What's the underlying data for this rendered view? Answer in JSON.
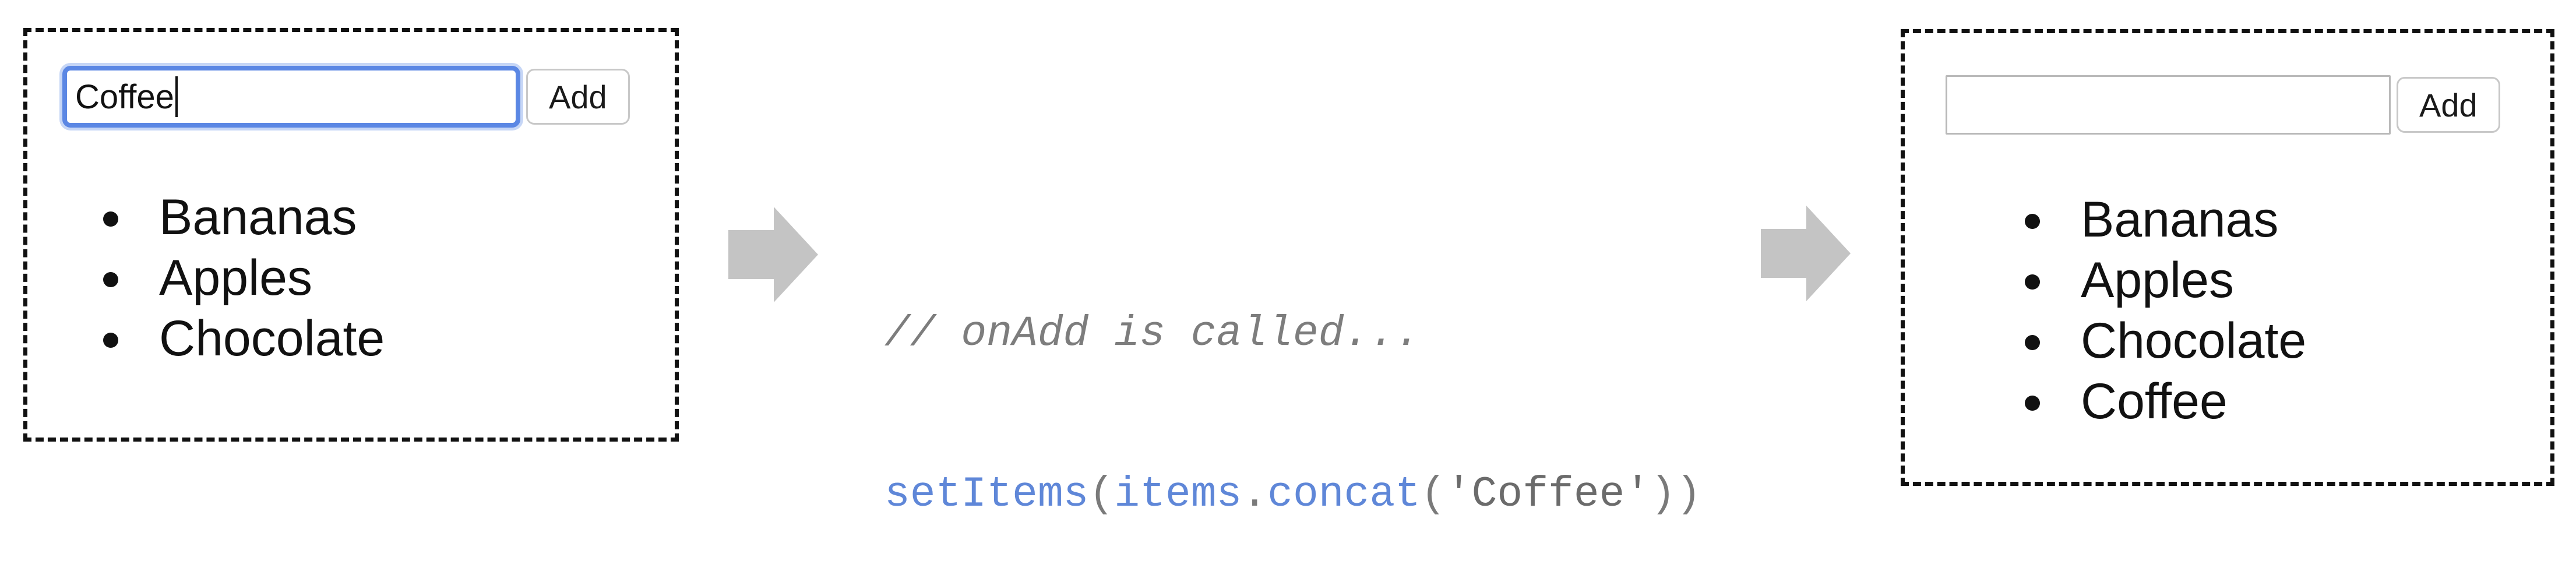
{
  "before": {
    "input_value": "Coffee",
    "add_label": "Add",
    "items": [
      "Bananas",
      "Apples",
      "Chocolate"
    ]
  },
  "code": {
    "comment": "// onAdd is called...",
    "fn_name": "setItems",
    "open_paren": "(",
    "arg_object": "items",
    "dot": ".",
    "method": "concat",
    "arg_open": "(",
    "string_arg": "'Coffee'",
    "close_parens": "))"
  },
  "after": {
    "input_value": "",
    "add_label": "Add",
    "items": [
      "Bananas",
      "Apples",
      "Chocolate",
      "Coffee"
    ]
  },
  "colors": {
    "focus_border": "#5b87e4",
    "code_identifier": "#5f87d8",
    "arrow": "#c4c4c4",
    "frame_border": "#111111"
  },
  "icons": {
    "arrow": "right-arrow-icon"
  }
}
